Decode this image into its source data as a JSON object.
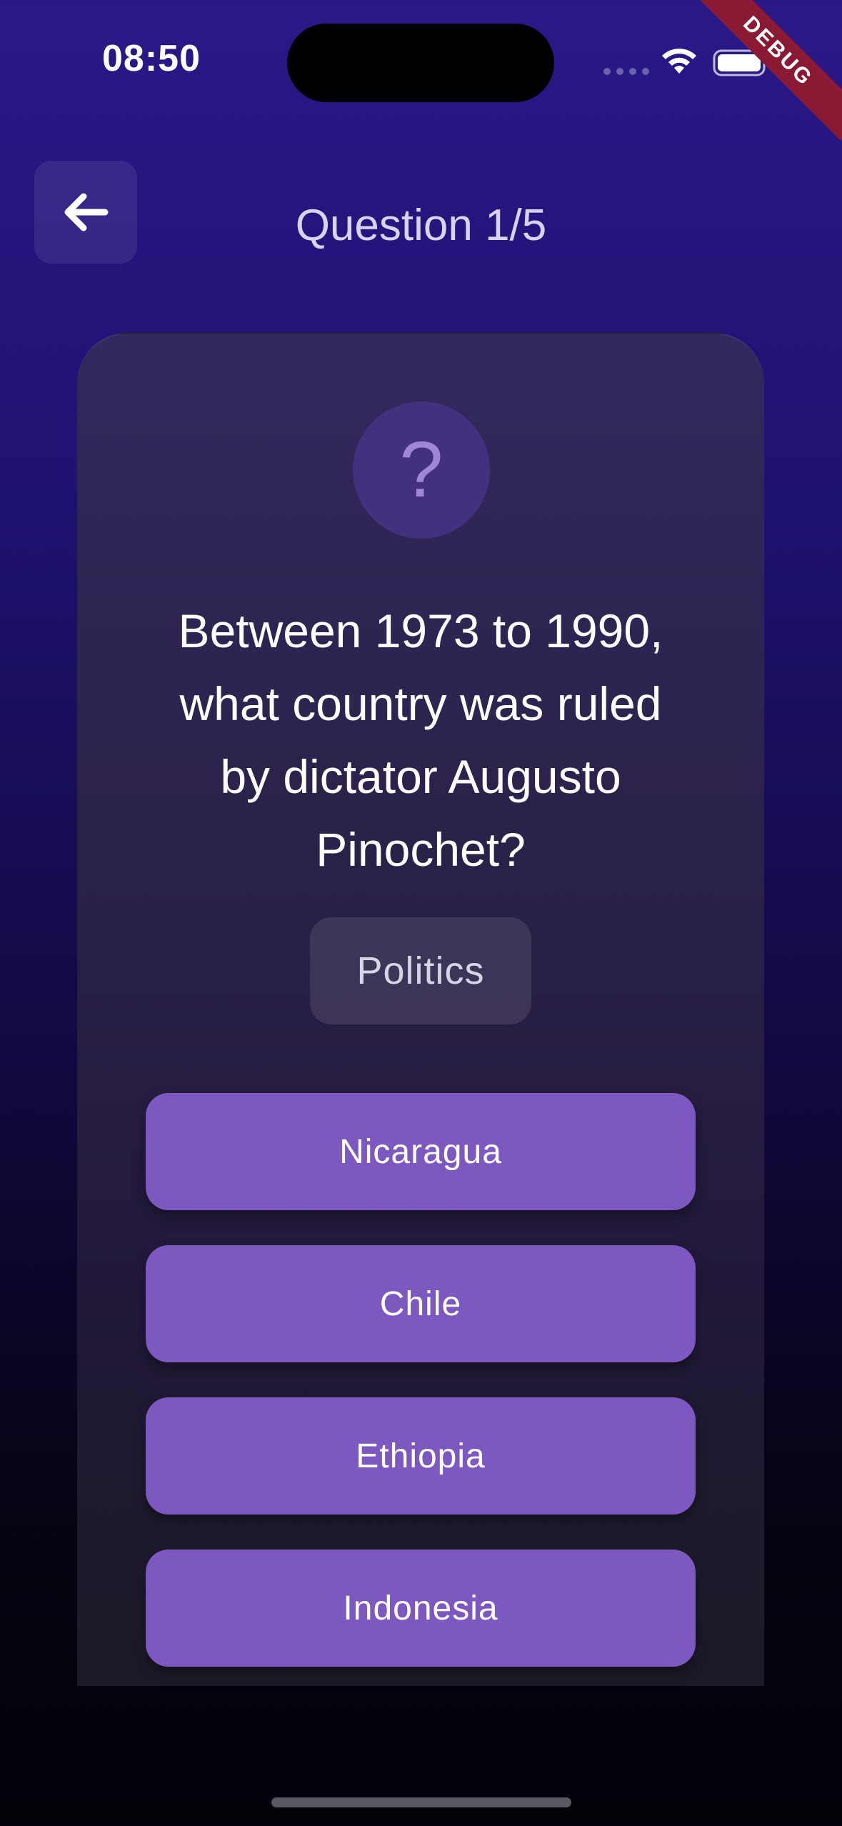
{
  "status_bar": {
    "time": "08:50"
  },
  "debug_banner": "DEBUG",
  "header": {
    "title": "Question 1/5"
  },
  "question": {
    "icon_glyph": "?",
    "text": "Between 1973 to 1990, what country was ruled by dictator Augusto Pinochet?",
    "category": "Politics"
  },
  "answers": [
    {
      "label": "Nicaragua"
    },
    {
      "label": "Chile"
    },
    {
      "label": "Ethiopia"
    },
    {
      "label": "Indonesia"
    }
  ],
  "colors": {
    "answer_button": "#7d58c1",
    "background_top": "#2a1887",
    "background_bottom": "#020108",
    "debug_ribbon": "#8a1a34"
  }
}
